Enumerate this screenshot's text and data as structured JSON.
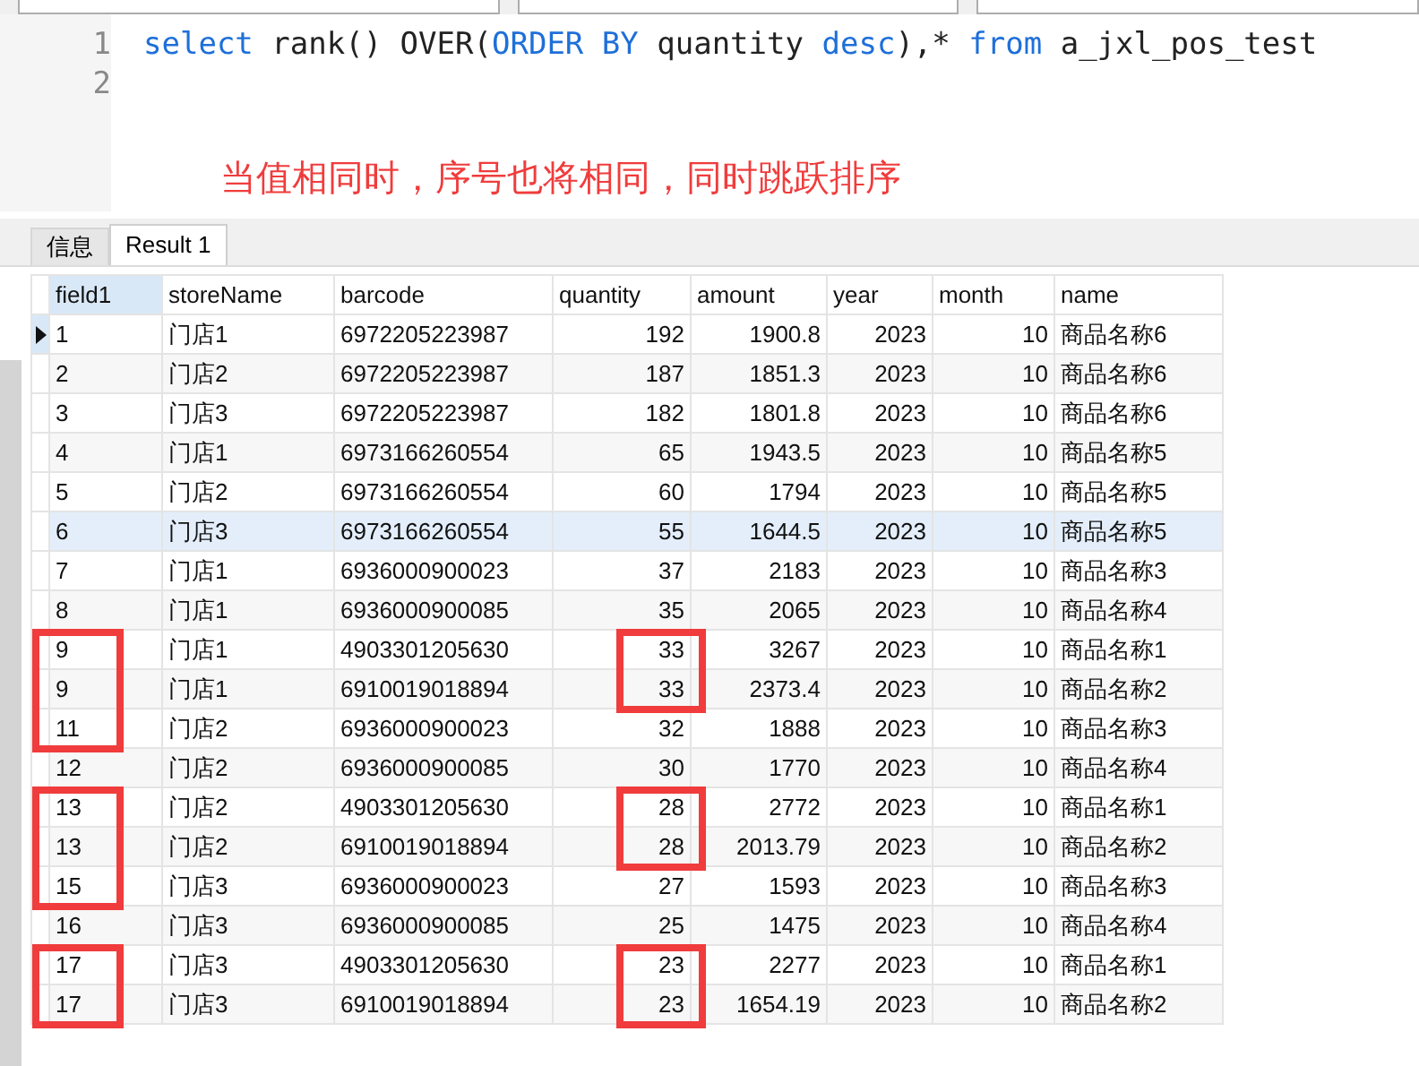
{
  "editor": {
    "lines": [
      {
        "number": "1",
        "tokens": [
          {
            "text": "select",
            "kind": "keyword"
          },
          {
            "text": " rank() OVER(",
            "kind": "plain"
          },
          {
            "text": "ORDER BY",
            "kind": "keyword"
          },
          {
            "text": " quantity ",
            "kind": "plain"
          },
          {
            "text": "desc",
            "kind": "keyword"
          },
          {
            "text": "),* ",
            "kind": "plain"
          },
          {
            "text": "from",
            "kind": "keyword"
          },
          {
            "text": " a_jxl_pos_test",
            "kind": "plain"
          }
        ]
      },
      {
        "number": "2"
      }
    ],
    "annotation": "当值相同时，序号也将相同，同时跳跃排序"
  },
  "tabs": [
    {
      "label": "信息",
      "selected": false
    },
    {
      "label": "Result 1",
      "selected": true
    }
  ],
  "table": {
    "columns": [
      {
        "label": "field1",
        "kind": "text"
      },
      {
        "label": "storeName",
        "kind": "text"
      },
      {
        "label": "barcode",
        "kind": "text"
      },
      {
        "label": "quantity",
        "kind": "number"
      },
      {
        "label": "amount",
        "kind": "number"
      },
      {
        "label": "year",
        "kind": "number"
      },
      {
        "label": "month",
        "kind": "number"
      },
      {
        "label": "name",
        "kind": "text"
      }
    ],
    "rows": [
      {
        "cells": [
          "1",
          "门店1",
          "6972205223987",
          "192",
          "1900.8",
          "2023",
          "10",
          "商品名称6"
        ],
        "current": true,
        "hovered": false,
        "rank_marked": false,
        "quantity_marked": false
      },
      {
        "cells": [
          "2",
          "门店2",
          "6972205223987",
          "187",
          "1851.3",
          "2023",
          "10",
          "商品名称6"
        ],
        "current": false,
        "hovered": false,
        "rank_marked": false,
        "quantity_marked": false
      },
      {
        "cells": [
          "3",
          "门店3",
          "6972205223987",
          "182",
          "1801.8",
          "2023",
          "10",
          "商品名称6"
        ],
        "current": false,
        "hovered": false,
        "rank_marked": false,
        "quantity_marked": false
      },
      {
        "cells": [
          "4",
          "门店1",
          "6973166260554",
          "65",
          "1943.5",
          "2023",
          "10",
          "商品名称5"
        ],
        "current": false,
        "hovered": false,
        "rank_marked": false,
        "quantity_marked": false
      },
      {
        "cells": [
          "5",
          "门店2",
          "6973166260554",
          "60",
          "1794",
          "2023",
          "10",
          "商品名称5"
        ],
        "current": false,
        "hovered": false,
        "rank_marked": false,
        "quantity_marked": false
      },
      {
        "cells": [
          "6",
          "门店3",
          "6973166260554",
          "55",
          "1644.5",
          "2023",
          "10",
          "商品名称5"
        ],
        "current": false,
        "hovered": true,
        "rank_marked": false,
        "quantity_marked": false
      },
      {
        "cells": [
          "7",
          "门店1",
          "6936000900023",
          "37",
          "2183",
          "2023",
          "10",
          "商品名称3"
        ],
        "current": false,
        "hovered": false,
        "rank_marked": false,
        "quantity_marked": false
      },
      {
        "cells": [
          "8",
          "门店1",
          "6936000900085",
          "35",
          "2065",
          "2023",
          "10",
          "商品名称4"
        ],
        "current": false,
        "hovered": false,
        "rank_marked": false,
        "quantity_marked": false
      },
      {
        "cells": [
          "9",
          "门店1",
          "4903301205630",
          "33",
          "3267",
          "2023",
          "10",
          "商品名称1"
        ],
        "current": false,
        "hovered": false,
        "rank_marked": true,
        "quantity_marked": true
      },
      {
        "cells": [
          "9",
          "门店1",
          "6910019018894",
          "33",
          "2373.4",
          "2023",
          "10",
          "商品名称2"
        ],
        "current": false,
        "hovered": false,
        "rank_marked": true,
        "quantity_marked": true
      },
      {
        "cells": [
          "11",
          "门店2",
          "6936000900023",
          "32",
          "1888",
          "2023",
          "10",
          "商品名称3"
        ],
        "current": false,
        "hovered": false,
        "rank_marked": true,
        "quantity_marked": false
      },
      {
        "cells": [
          "12",
          "门店2",
          "6936000900085",
          "30",
          "1770",
          "2023",
          "10",
          "商品名称4"
        ],
        "current": false,
        "hovered": false,
        "rank_marked": false,
        "quantity_marked": false
      },
      {
        "cells": [
          "13",
          "门店2",
          "4903301205630",
          "28",
          "2772",
          "2023",
          "10",
          "商品名称1"
        ],
        "current": false,
        "hovered": false,
        "rank_marked": true,
        "quantity_marked": true
      },
      {
        "cells": [
          "13",
          "门店2",
          "6910019018894",
          "28",
          "2013.79",
          "2023",
          "10",
          "商品名称2"
        ],
        "current": false,
        "hovered": false,
        "rank_marked": true,
        "quantity_marked": true
      },
      {
        "cells": [
          "15",
          "门店3",
          "6936000900023",
          "27",
          "1593",
          "2023",
          "10",
          "商品名称3"
        ],
        "current": false,
        "hovered": false,
        "rank_marked": true,
        "quantity_marked": false
      },
      {
        "cells": [
          "16",
          "门店3",
          "6936000900085",
          "25",
          "1475",
          "2023",
          "10",
          "商品名称4"
        ],
        "current": false,
        "hovered": false,
        "rank_marked": false,
        "quantity_marked": false
      },
      {
        "cells": [
          "17",
          "门店3",
          "4903301205630",
          "23",
          "2277",
          "2023",
          "10",
          "商品名称1"
        ],
        "current": false,
        "hovered": false,
        "rank_marked": true,
        "quantity_marked": true
      },
      {
        "cells": [
          "17",
          "门店3",
          "6910019018894",
          "23",
          "1654.19",
          "2023",
          "10",
          "商品名称2"
        ],
        "current": false,
        "hovered": false,
        "rank_marked": true,
        "quantity_marked": true
      }
    ]
  }
}
